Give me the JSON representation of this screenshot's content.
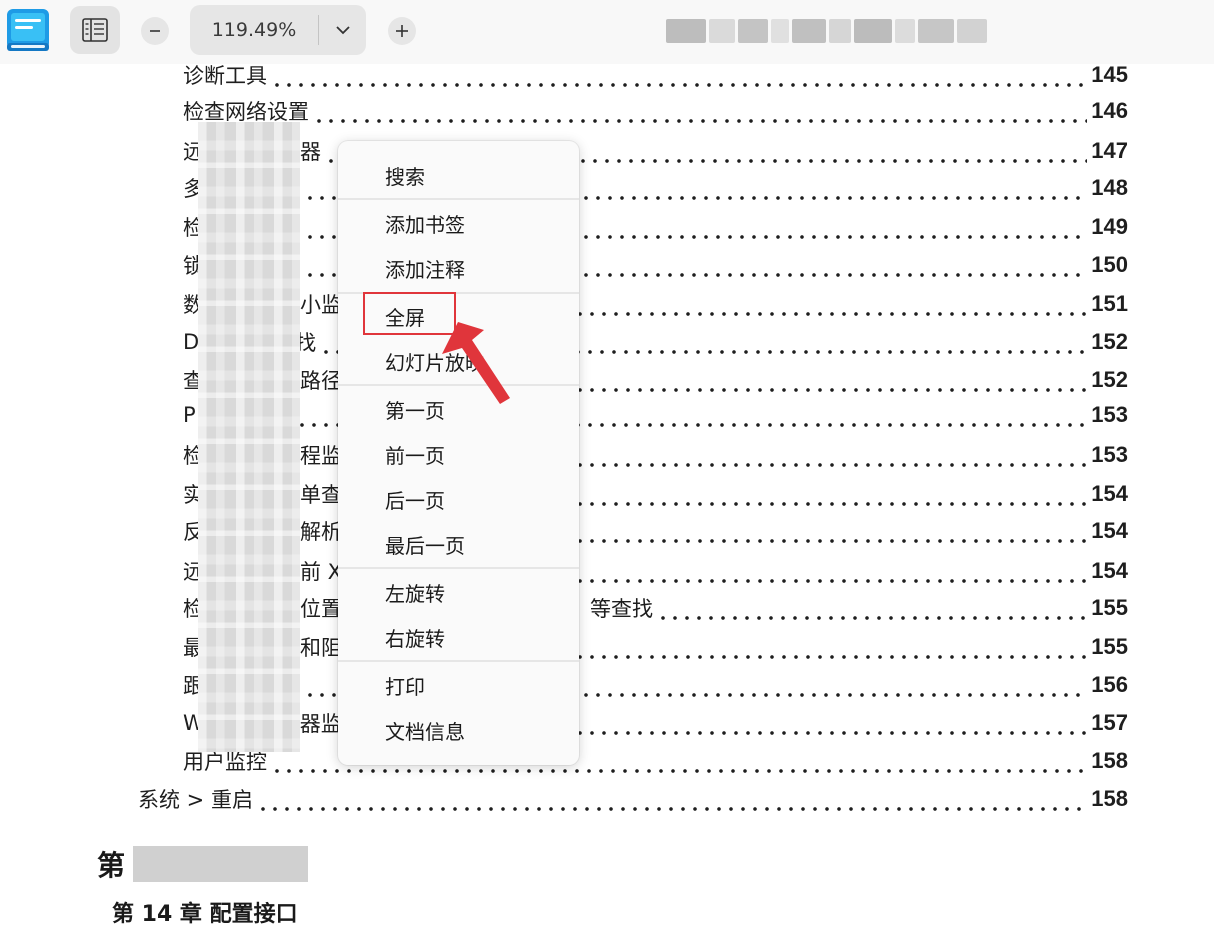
{
  "toolbar": {
    "zoom_value": "119.49%",
    "icons": {
      "app": "document-viewer-app-icon",
      "thumbnail": "thumbnail-panel-icon",
      "zoom_out": "minus-icon",
      "zoom_dropdown": "chevron-down-icon",
      "zoom_in": "plus-icon"
    }
  },
  "toc": {
    "rows": [
      {
        "text": "诊断工具",
        "page": "145"
      },
      {
        "text": "检查网络设置",
        "page": "146"
      },
      {
        "text": "远",
        "suffix": "器",
        "page": "147"
      },
      {
        "text": "多",
        "page": "148"
      },
      {
        "text": "检",
        "page": "149"
      },
      {
        "text": "锁",
        "page": "150"
      },
      {
        "text": "数",
        "suffix": "小监",
        "page": "151"
      },
      {
        "text": "D",
        "suffix": "找",
        "page": "152"
      },
      {
        "text": "查",
        "suffix": "路径",
        "page": "152"
      },
      {
        "text": "P",
        "page": "153"
      },
      {
        "text": "检",
        "suffix": "程监",
        "page": "153"
      },
      {
        "text": "实",
        "suffix": "单查",
        "page": "154"
      },
      {
        "text": "反",
        "suffix": "解析",
        "page": "154"
      },
      {
        "text": "远",
        "suffix": "前 X",
        "page": "154"
      },
      {
        "text": "检",
        "suffix": "位置",
        "tail": "等查找",
        "page": "155"
      },
      {
        "text": "最",
        "suffix": "和阻",
        "page": "155"
      },
      {
        "text": "跟",
        "page": "156"
      },
      {
        "text": "W",
        "suffix": "器监",
        "page": "157"
      },
      {
        "text": "用户监控",
        "page": "158"
      }
    ],
    "last_row": {
      "text": "系统 > 重启",
      "page": "158"
    },
    "chapter_prefix": "第",
    "sub_chapter": "第 14 章 配置接口"
  },
  "menu": {
    "items": [
      {
        "label": "搜索"
      },
      {
        "label": "添加书签"
      },
      {
        "label": "添加注释"
      },
      {
        "label": "全屏"
      },
      {
        "label": "幻灯片放映"
      },
      {
        "label": "第一页"
      },
      {
        "label": "前一页"
      },
      {
        "label": "后一页"
      },
      {
        "label": "最后一页"
      },
      {
        "label": "左旋转"
      },
      {
        "label": "右旋转"
      },
      {
        "label": "打印"
      },
      {
        "label": "文档信息"
      }
    ],
    "highlight_color": "#e0353b"
  },
  "colors": {
    "toolbar_bg": "#f8f8f8",
    "menu_bg": "#fafafa",
    "app_icon_blue": "#1e9be6"
  }
}
